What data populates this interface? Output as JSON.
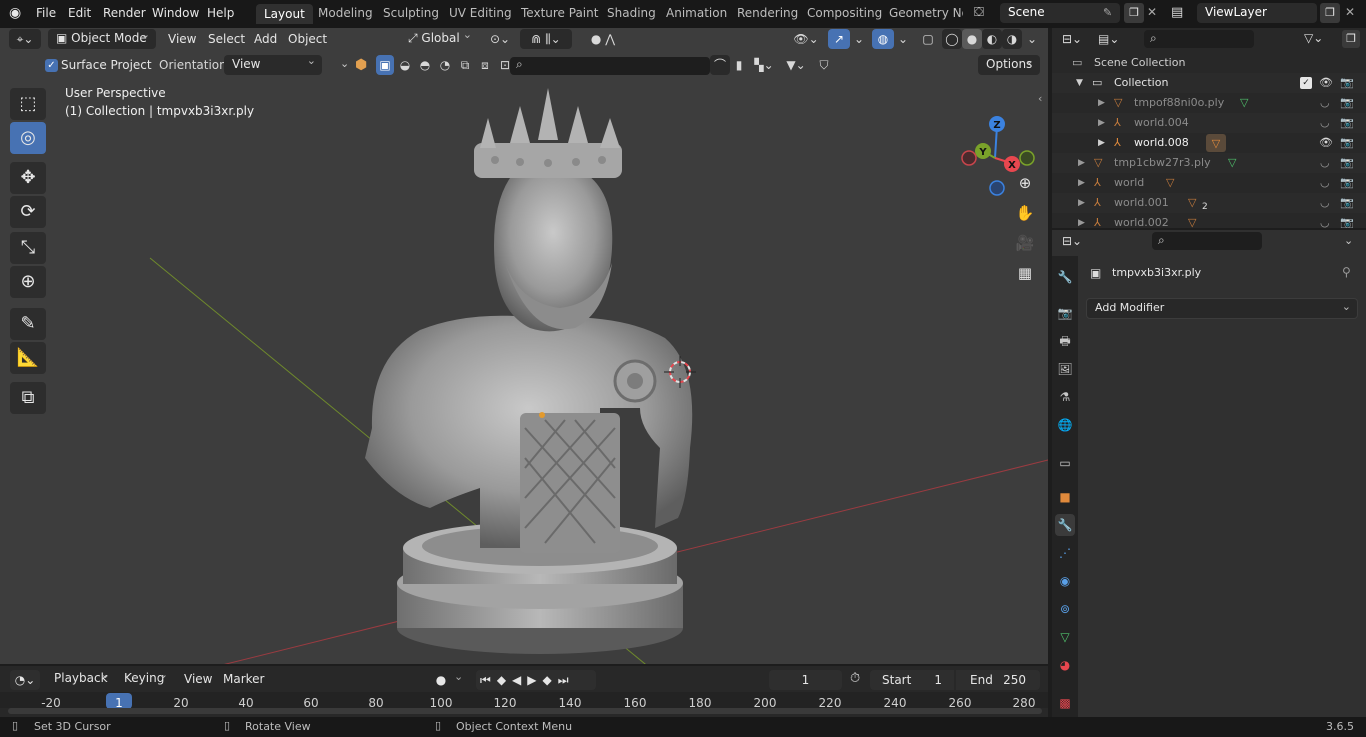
{
  "topbar": {
    "menus": [
      "File",
      "Edit",
      "Render",
      "Window",
      "Help"
    ],
    "workspaces": [
      "Layout",
      "Modeling",
      "Sculpting",
      "UV Editing",
      "Texture Paint",
      "Shading",
      "Animation",
      "Rendering",
      "Compositing",
      "Geometry Noc"
    ],
    "active_workspace": "Layout",
    "scene": "Scene",
    "view_layer": "ViewLayer"
  },
  "viewport_header": {
    "mode": "Object Mode",
    "menus": [
      "View",
      "Select",
      "Add",
      "Object"
    ],
    "orientation": "Global"
  },
  "tool_settings": {
    "surface_project_label": "Surface Project",
    "surface_project_checked": true,
    "orientation_label": "Orientation:",
    "orientation_value": "View",
    "options_label": "Options"
  },
  "viewport": {
    "view_name": "User Perspective",
    "collection_info": "(1) Collection | tmpvxb3i3xr.ply",
    "gizmo_axes": [
      "Z",
      "Y",
      "X"
    ]
  },
  "outliner": {
    "rows": [
      {
        "name": "Scene Collection",
        "type": "scene"
      },
      {
        "name": "Collection",
        "type": "collection"
      },
      {
        "name": "tmpof88ni0o.ply",
        "type": "mesh"
      },
      {
        "name": "world.004",
        "type": "empty"
      },
      {
        "name": "world.008",
        "type": "empty"
      },
      {
        "name": "tmp1cbw27r3.ply",
        "type": "mesh"
      },
      {
        "name": "world",
        "type": "mesh"
      },
      {
        "name": "world.001",
        "type": "mesh",
        "badge": "2"
      },
      {
        "name": "world.002",
        "type": "mesh"
      }
    ]
  },
  "properties": {
    "object_name": "tmpvxb3i3xr.ply",
    "add_modifier_label": "Add Modifier"
  },
  "timeline": {
    "menus": [
      "Playback",
      "Keying",
      "View",
      "Marker"
    ],
    "current_frame": "1",
    "start_label": "Start",
    "start_value": "1",
    "end_label": "End",
    "end_value": "250",
    "ticks": [
      "-20",
      "1",
      "20",
      "40",
      "60",
      "80",
      "100",
      "120",
      "140",
      "160",
      "180",
      "200",
      "220",
      "240",
      "260",
      "280"
    ]
  },
  "statusbar": {
    "items": [
      "Set 3D Cursor",
      "Rotate View",
      "Object Context Menu"
    ],
    "version": "3.6.5"
  },
  "colors": {
    "accent": "#4772b3",
    "viewport_bg": "#3d3d3d",
    "axis_x": "#e8474f",
    "axis_y": "#7aa22a",
    "axis_z": "#3b82e0"
  }
}
